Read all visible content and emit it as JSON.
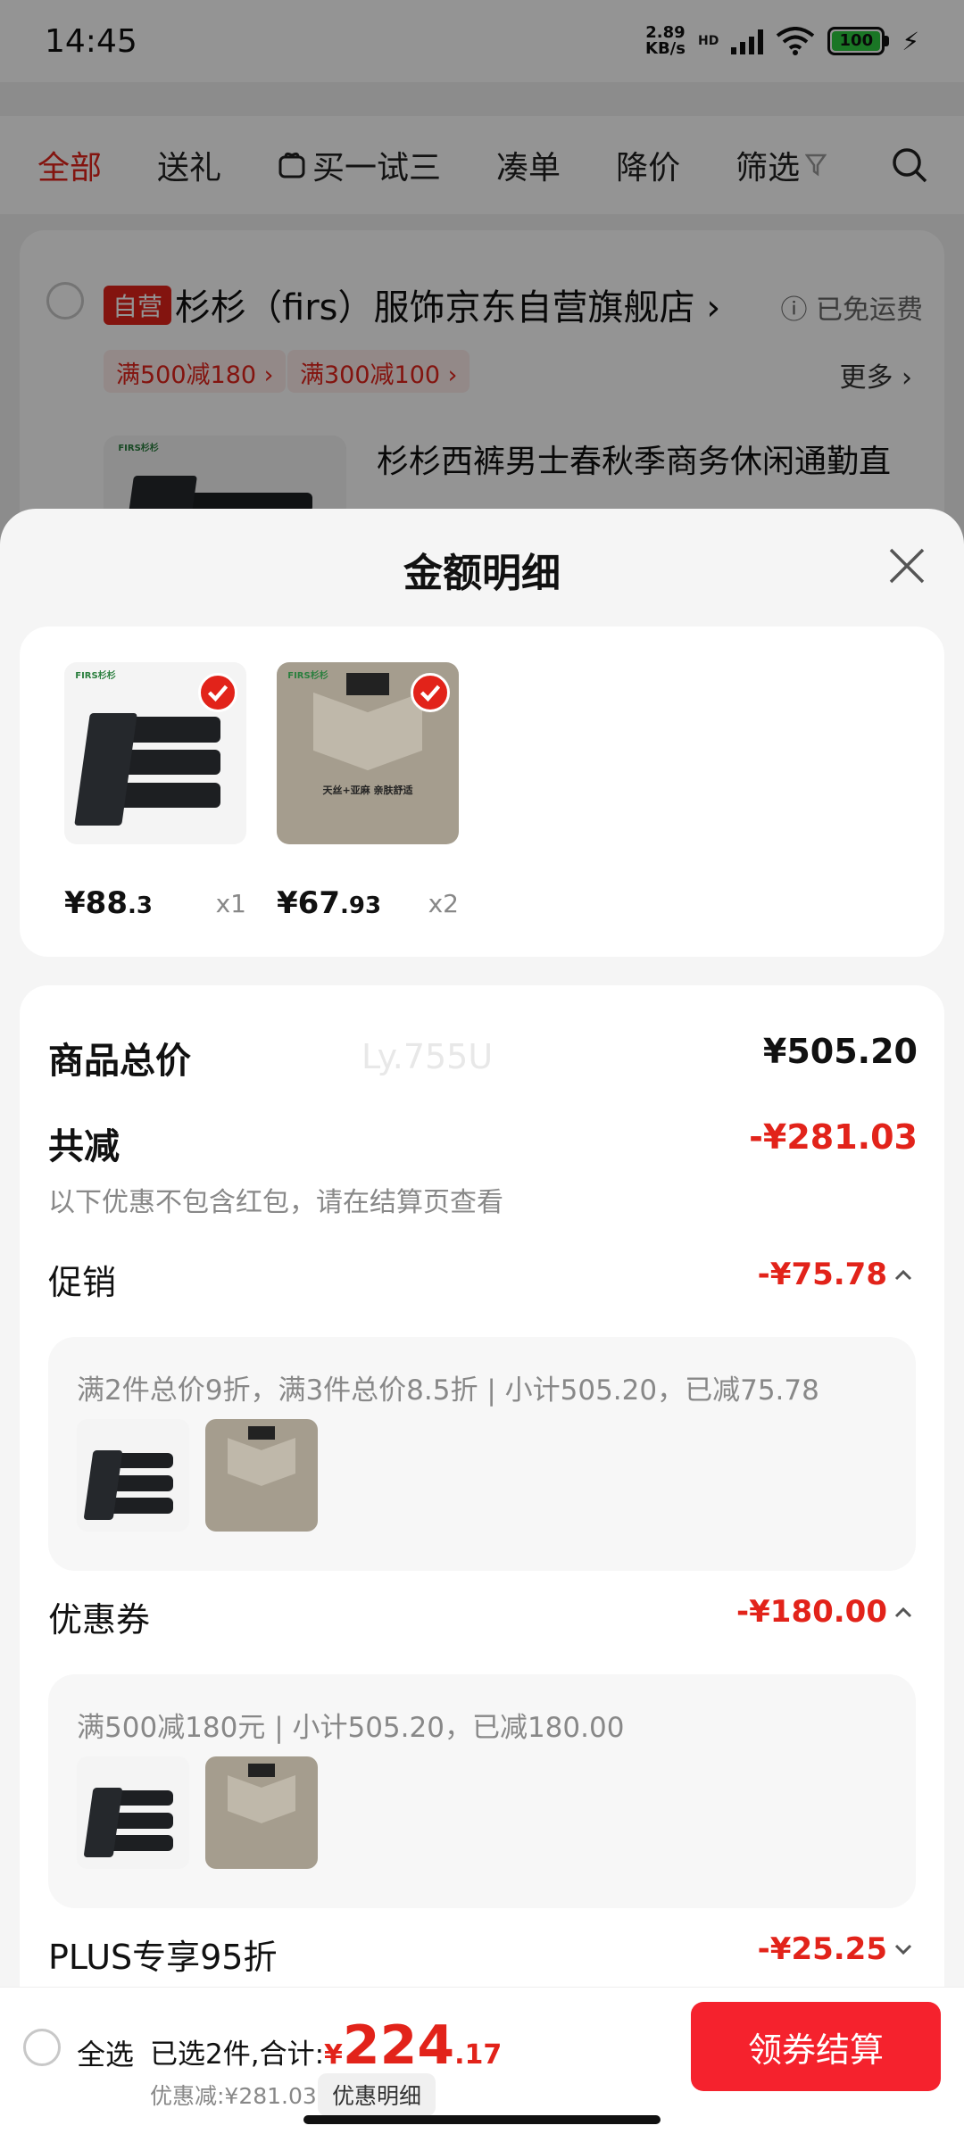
{
  "status_bar": {
    "time": "14:45",
    "net_speed_value": "2.89",
    "net_speed_unit": "KB/s",
    "hd_label": "HD",
    "battery": "100"
  },
  "tabs": [
    "全部",
    "送礼",
    "买一试三",
    "凑单",
    "降价",
    "筛选"
  ],
  "store": {
    "badge": "自营",
    "name": "杉杉（firs）服饰京东自营旗舰店 ›",
    "free_shipping": "ⓘ 已免运费",
    "coupons": [
      "满500减180 ›",
      "满300减100 ›"
    ],
    "more": "更多 ›",
    "product_title": "杉杉西裤男士春秋季商务休闲通勤直"
  },
  "sheet": {
    "title": "金额明细",
    "goods": [
      {
        "price_int": "¥88",
        "price_dec": ".3",
        "qty": "x1",
        "kind": "pants"
      },
      {
        "price_int": "¥67",
        "price_dec": ".93",
        "qty": "x2",
        "kind": "shirt"
      }
    ],
    "brand_label": "FIRS杉杉",
    "shirt_caption": "天丝+亚麻 亲肤舒适",
    "watermark": "Ly.755U",
    "total_label": "商品总价",
    "total_value": "¥505.20",
    "reduce_label": "共减",
    "reduce_value": "-¥281.03",
    "reduce_note": "以下优惠不包含红包，请在结算页查看",
    "promo": {
      "label": "促销",
      "value": "-¥75.78",
      "desc": "满2件总价9折，满3件总价8.5折 | 小计505.20，已减75.78"
    },
    "coupon": {
      "label": "优惠券",
      "value": "-¥180.00",
      "desc": "满500减180元 | 小计505.20，已减180.00"
    },
    "plus": {
      "label": "PLUS专享95折",
      "value": "-¥25.25"
    }
  },
  "bottom_bar": {
    "select_all": "全选",
    "sum_prefix": "已选2件,合计:",
    "sum_currency": "¥",
    "sum_int": "224",
    "sum_dec": ".17",
    "discount": "优惠减:¥281.03",
    "detail_chip": "优惠明细",
    "checkout": "领券结算"
  },
  "colors": {
    "accent": "#e2231a",
    "checkout": "#f5222d"
  }
}
